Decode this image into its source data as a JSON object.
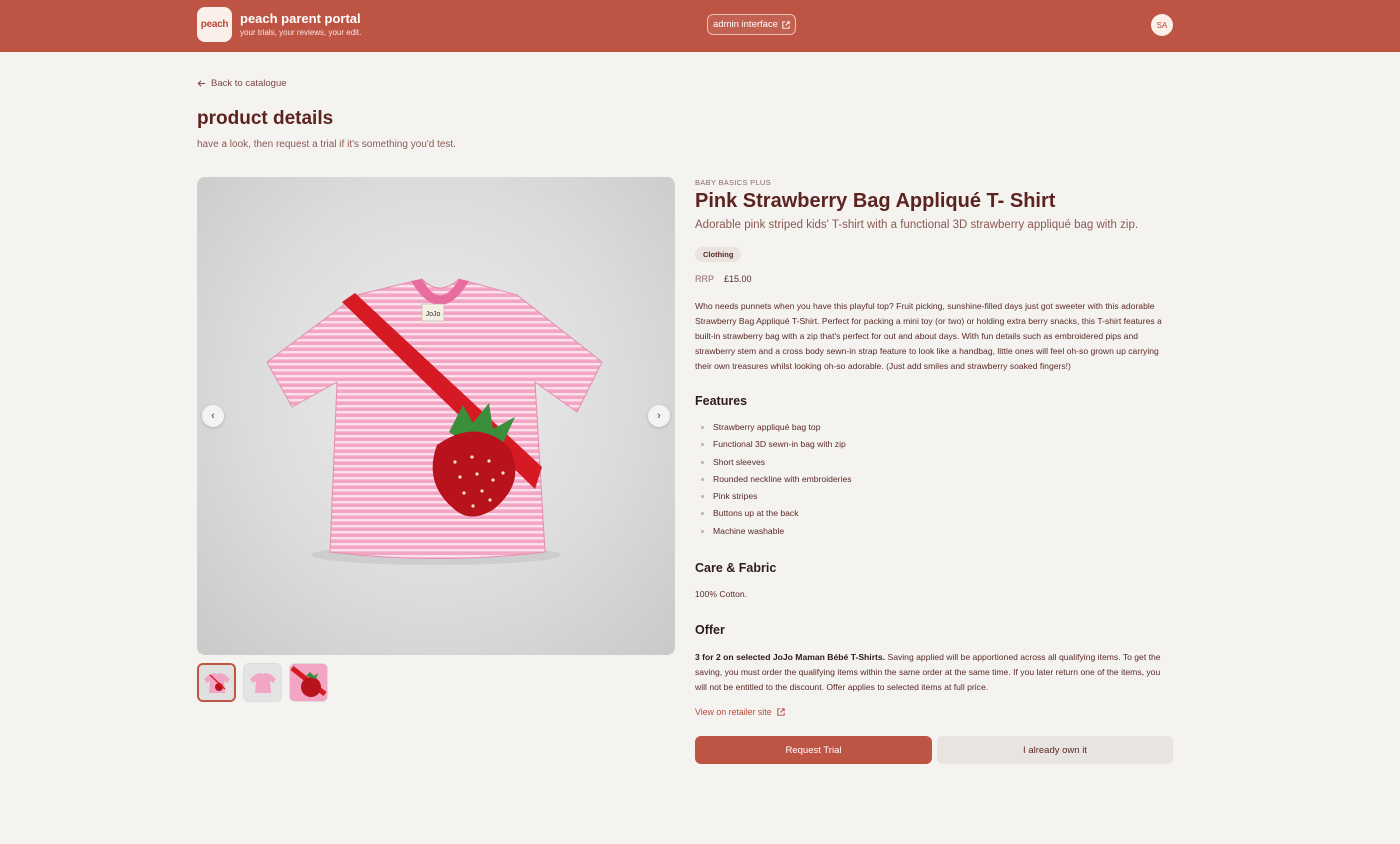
{
  "header": {
    "logo_text": "peach",
    "app_title": "peach parent portal",
    "app_subtitle": "your trials, your reviews, your edit.",
    "admin_label": "admin interface",
    "avatar_initials": "SA"
  },
  "page": {
    "back_label": "Back to catalogue",
    "title": "product details",
    "subtitle": "have a look, then request a trial if it's something you'd test."
  },
  "product": {
    "brand": "BABY BASICS PLUS",
    "name": "Pink Strawberry Bag Appliqué T- Shirt",
    "tagline": "Adorable pink striped kids' T-shirt with a functional 3D strawberry appliqué bag with zip.",
    "category": "Clothing",
    "price_label": "RRP",
    "price": "£15.00",
    "description": "Who needs punnets when you have this playful top? Fruit picking, sunshine-filled days just got sweeter with this adorable Strawberry Bag Appliqué T-Shirt. Perfect for packing a mini toy (or two) or holding extra berry snacks, this T-shirt features a built-in strawberry bag with a zip that's perfect for out and about days. With fun details such as embroidered pips and strawberry stem and a cross body sewn-in strap feature to look like a handbag, little ones will feel oh-so grown up carrying their own treasures whilst looking oh-so adorable. (Just add smiles and strawberry soaked fingers!)",
    "features_heading": "Features",
    "features": [
      "Strawberry appliqué bag top",
      "Functional 3D sewn-in bag with zip",
      "Short sleeves",
      "Rounded neckline with embroideries",
      "Pink stripes",
      "Buttons up at the back",
      "Machine washable"
    ],
    "care_heading": "Care & Fabric",
    "care_text": "100% Cotton.",
    "offer_heading": "Offer",
    "offer_bold": "3 for 2 on selected JoJo Maman Bébé T-Shirts.",
    "offer_text": " Saving applied will be apportioned across all qualifying items. To get the saving, you must order the qualifying items within the same order at the same time. If you later return one of the items, you will not be entitled to the discount. Offer applies to selected items at full price.",
    "retailer_link": "View on retailer site"
  },
  "gallery": {
    "label_text": "JoJo",
    "image_count": 3,
    "active_index": 0
  },
  "actions": {
    "request_label": "Request Trial",
    "own_label": "I already own it"
  },
  "colors": {
    "accent": "#bd5444",
    "background": "#f5f3f0",
    "title": "#5c2420"
  }
}
